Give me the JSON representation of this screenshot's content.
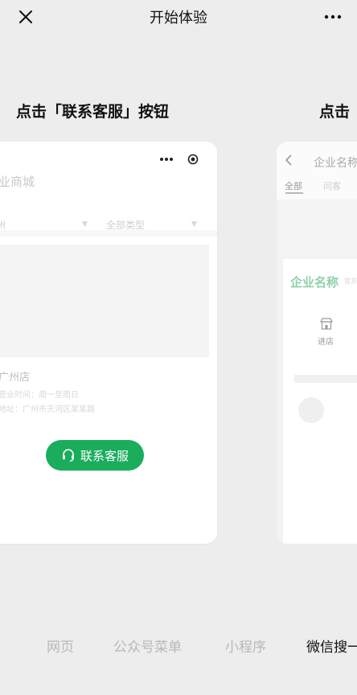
{
  "nav": {
    "title": "开始体验",
    "close_icon": "close-icon",
    "more_icon": "more-dots-icon"
  },
  "step": {
    "main_title": "点击「联系客服」按钮",
    "next_title": "点击"
  },
  "demo_card": {
    "shop_name": "业商城",
    "filter_city": "州",
    "filter_type": "全部类型",
    "store_name": "广州店",
    "store_line1": "营业时间：周一至周日",
    "store_line2": "地址：广州市天河区某某路",
    "contact_button": "联系客服",
    "colors": {
      "button": "#1aad5c"
    }
  },
  "next_card": {
    "top_title": "企业名称",
    "tab_all": "全部",
    "tab_question": "问客",
    "enterprise_name": "企业名称",
    "enterprise_tag": "官方",
    "store_label": "进店",
    "colors": {
      "enterprise_name": "#8fd1a9"
    }
  },
  "bottom_tabs": [
    {
      "label": "网页",
      "active": false
    },
    {
      "label": "公众号菜单",
      "active": false
    },
    {
      "label": "小程序",
      "active": false
    },
    {
      "label": "微信搜一",
      "active": true
    }
  ]
}
